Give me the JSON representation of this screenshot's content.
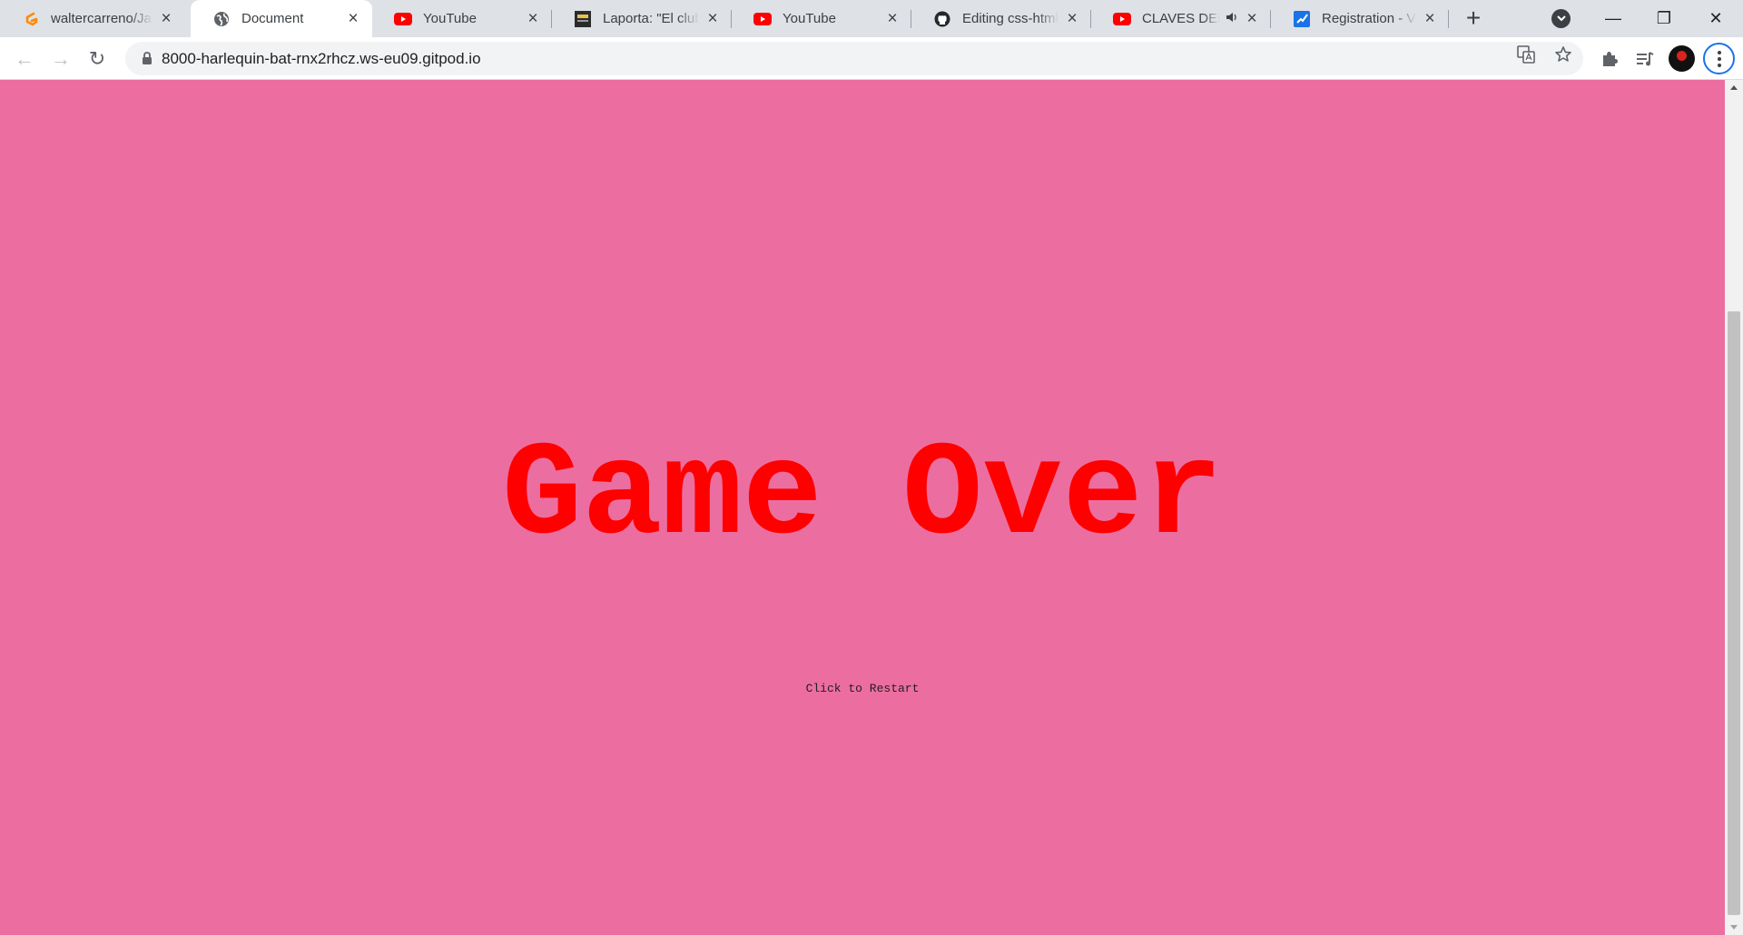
{
  "tabs": [
    {
      "title": "waltercarreno/JavaScript",
      "icon": "gitpod-icon"
    },
    {
      "title": "Document",
      "icon": "globe-icon",
      "active": true
    },
    {
      "title": "YouTube",
      "icon": "youtube-icon"
    },
    {
      "title": "Laporta: \"El club es...",
      "icon": "news-icon"
    },
    {
      "title": "YouTube",
      "icon": "youtube-icon"
    },
    {
      "title": "Editing css-html/README",
      "icon": "github-icon"
    },
    {
      "title": "CLAVES DEL JUEGO",
      "icon": "youtube-icon",
      "audio": true
    },
    {
      "title": "Registration - Vrije",
      "icon": "form-icon"
    }
  ],
  "window": {
    "new_tab": "+",
    "minimize": "—",
    "maximize": "❐",
    "close": "✕"
  },
  "toolbar": {
    "url": "8000-harlequin-bat-rnx2rhcz.ws-eu09.gitpod.io",
    "back": "←",
    "forward": "→",
    "reload": "↻"
  },
  "page": {
    "heading": "Game Over",
    "restart_label": "Click to Restart",
    "background_color": "#ec6ea0",
    "heading_color": "#ff0000"
  }
}
